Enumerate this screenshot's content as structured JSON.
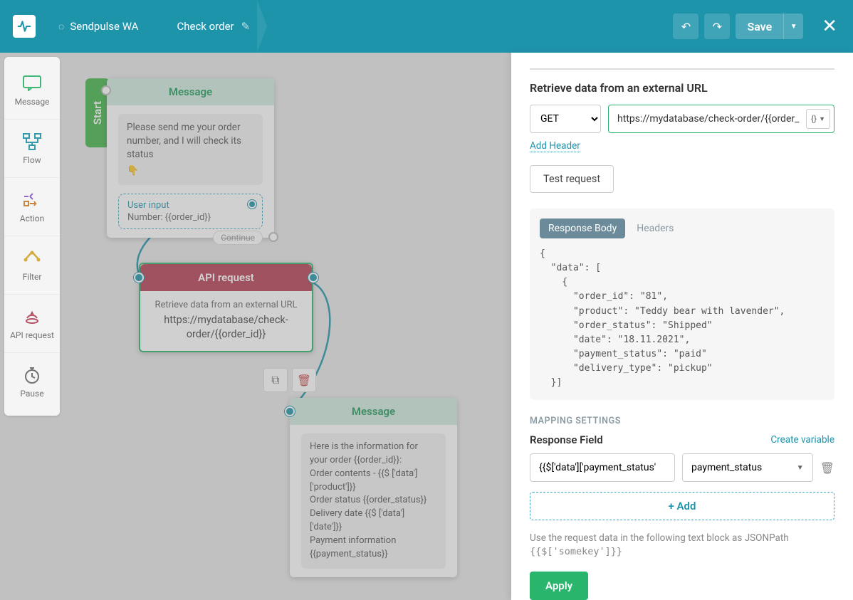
{
  "header": {
    "breadcrumb1": "Sendpulse WA",
    "breadcrumb2": "Check order",
    "save_label": "Save"
  },
  "palette": {
    "message": "Message",
    "flow": "Flow",
    "action": "Action",
    "filter": "Filter",
    "api": "API request",
    "pause": "Pause"
  },
  "canvas": {
    "start_label": "Start",
    "node1": {
      "title": "Message",
      "text": "Please send me your order number, and I will check its status",
      "user_input_title": "User input",
      "user_input_value": "Number: {{order_id}}",
      "continue": "Continue"
    },
    "node2": {
      "title": "API request",
      "subtitle": "Retrieve data from an external URL",
      "url": "https://mydatabase/check-order/{{order_id}}"
    },
    "node3": {
      "title": "Message",
      "text": "Here is the information for your order {{order_id}}:\nOrder contents - {{$ ['data']['product']}}\nOrder status {{order_status}}\nDelivery date {{$ ['data'] ['date']}}\nPayment information {{payment_status}}"
    }
  },
  "panel": {
    "title": "Retrieve data from an external URL",
    "method": "GET",
    "url_value": "https://mydatabase/check-order/{{order_",
    "add_header": "Add Header",
    "test_request": "Test request",
    "tab_body": "Response Body",
    "tab_headers": "Headers",
    "response_json": "{\n  \"data\": [\n    {\n      \"order_id\": \"81\",\n      \"product\": \"Teddy bear with lavender\",\n      \"order_status\": \"Shipped\"\n      \"date\": \"18.11.2021\",\n      \"payment_status\": \"paid\"\n      \"delivery_type\": \"pickup\"\n  }]",
    "mapping_label": "MAPPING SETTINGS",
    "response_field": "Response Field",
    "create_variable": "Create variable",
    "map_input": "{{$['data']['payment_status'",
    "map_select": "payment_status",
    "add": "+ Add",
    "help_text": "Use the request data in the following text block as JSONPath",
    "help_code": "{{$['somekey']}}",
    "apply": "Apply"
  }
}
